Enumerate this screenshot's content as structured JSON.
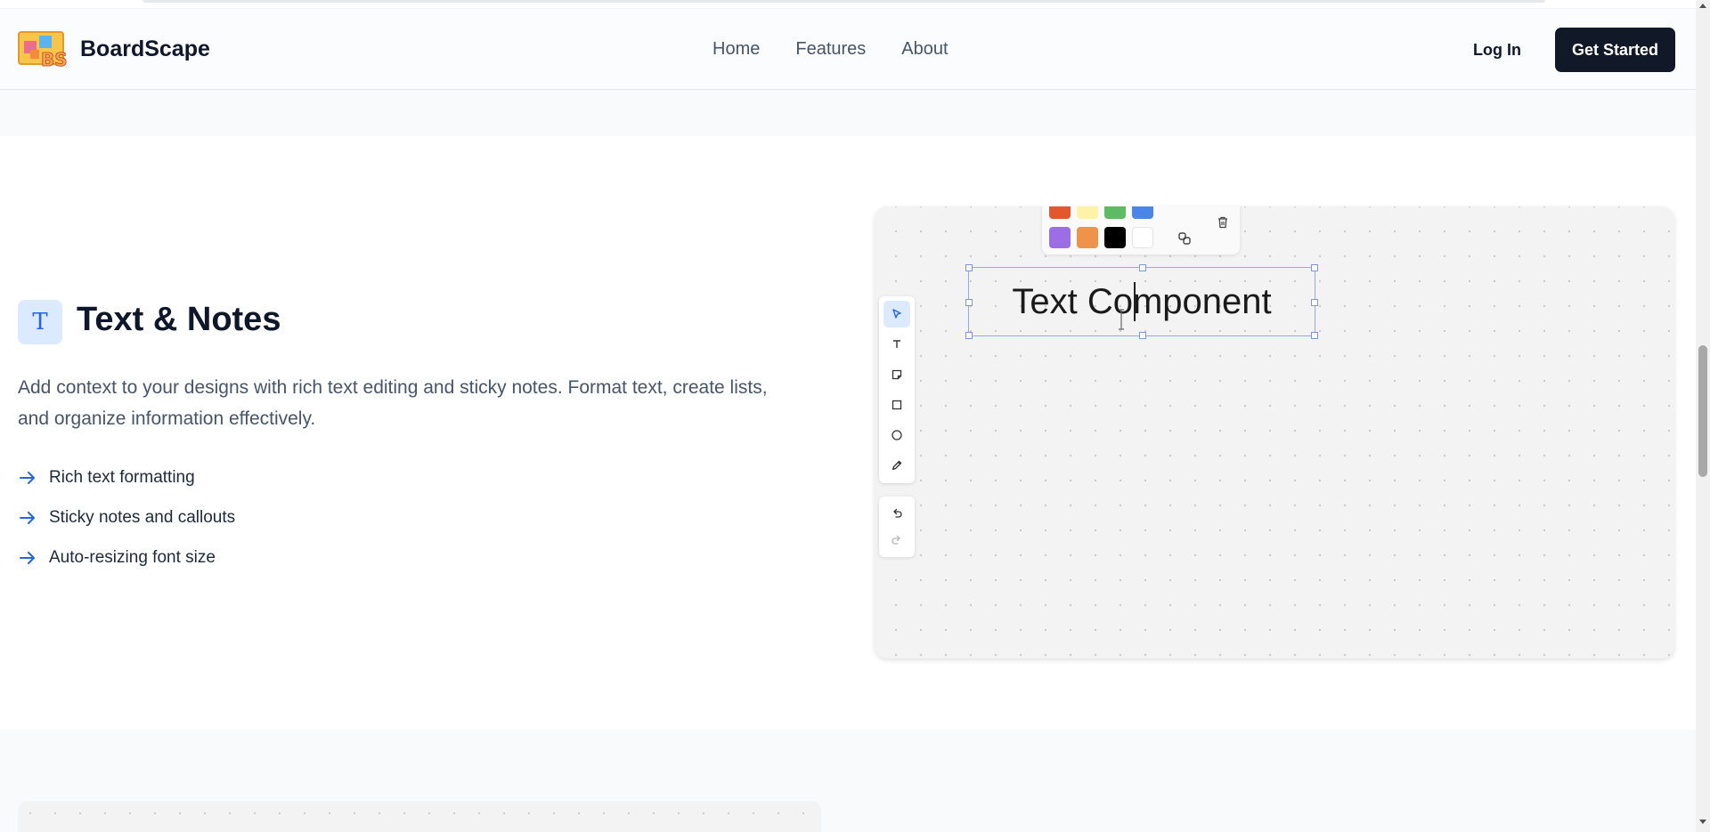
{
  "brand": {
    "name": "BoardScape",
    "logo_text": "BS",
    "logo_icon": "boardscape-logo"
  },
  "nav": {
    "items": [
      {
        "label": "Home"
      },
      {
        "label": "Features"
      },
      {
        "label": "About"
      }
    ]
  },
  "auth": {
    "login_label": "Log In",
    "cta_label": "Get Started"
  },
  "feature": {
    "icon": "text-T-icon",
    "icon_glyph": "T",
    "title": "Text & Notes",
    "description": "Add context to your designs with rich text editing and sticky notes. Format text, create lists, and organize information effectively.",
    "bullets": [
      "Rich text formatting",
      "Sticky notes and callouts",
      "Auto-resizing font size"
    ]
  },
  "demo": {
    "text_component": "Text Component",
    "palette_colors_top": [
      "#e4572e",
      "#fdf3a7",
      "#5dbb63",
      "#4a86e8"
    ],
    "palette_colors_bottom": [
      "#9b6ee6",
      "#f0934a",
      "#000000",
      "#ffffff"
    ],
    "palette_actions": [
      "link-icon",
      "trash-icon"
    ],
    "tools": [
      "select-icon",
      "text-icon",
      "sticky-note-icon",
      "rectangle-icon",
      "ellipse-icon",
      "pen-icon"
    ],
    "history": [
      "undo-icon",
      "redo-icon"
    ]
  },
  "colors": {
    "accent": "#2563eb",
    "cta_bg": "#111827",
    "feature_icon_bg": "#dbeafe"
  }
}
